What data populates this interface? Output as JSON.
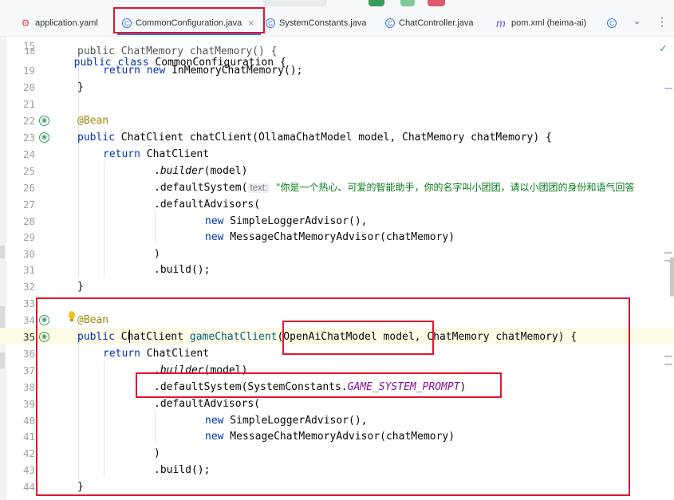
{
  "tabs": [
    {
      "label": "application.yaml",
      "icon": "yaml-icon"
    },
    {
      "label": "CommonConfiguration.java",
      "icon": "class-icon",
      "active": true,
      "closable": true
    },
    {
      "label": "SystemConstants.java",
      "icon": "class-icon"
    },
    {
      "label": "ChatController.java",
      "icon": "class-icon"
    },
    {
      "label": "pom.xml (heima-ai)",
      "icon": "maven-icon"
    }
  ],
  "tab_close_glyph": "×",
  "sticky_header": {
    "line": "15",
    "text": "public class CommonConfiguration {"
  },
  "line_numbers": [
    "18",
    "19",
    "20",
    "21",
    "22",
    "23",
    "24",
    "25",
    "26",
    "27",
    "28",
    "29",
    "30",
    "31",
    "32",
    "33",
    "34",
    "35",
    "36",
    "37",
    "38",
    "39",
    "40",
    "41",
    "42",
    "43",
    "44"
  ],
  "code": {
    "l18": "public ChatMemory chatMemory() {",
    "l19_kw": "return new",
    "l19_rest": " InMemoryChatMemory();",
    "l20": "}",
    "l22": "@Bean",
    "l23_kw": "public",
    "l23_type": "ChatClient",
    "l23_rest": " chatClient(OllamaChatModel model, ChatMemory chatMemory) {",
    "l24_kw": "return",
    "l24_type": "ChatClient",
    "l25_dot": ".",
    "l25_it": "builder",
    "l25_rest": "(model)",
    "l26_a": ".defaultSystem(",
    "l26_hint": "text:",
    "l26_str": "\"你是一个热心、可爱的智能助手，你的名字叫小团团，请以小团团的身份和语气回答",
    "l27": ".defaultAdvisors(",
    "l28_kw": "new",
    "l28_rest": " SimpleLoggerAdvisor(),",
    "l29_kw": "new",
    "l29_rest": " MessageChatMemoryAdvisor(chatMemory)",
    "l30": ")",
    "l31": ".build();",
    "l32": "}",
    "l34": "@Bean",
    "l35_kw": "public",
    "l35_a": "C",
    "l35_b": "hatClient",
    "l35_c": " gameChatClient",
    "l35_d": "(OpenAiChatModel model, ChatMemory chatMemory) {",
    "l36_kw": "return",
    "l36_type": "ChatClient",
    "l37_dot": ".",
    "l37_it": "builder",
    "l37_rest": "(model)",
    "l38_a": ".defaultSystem(SystemConstants.",
    "l38_cst": "GAME_SYSTEM_PROMPT",
    "l38_b": ")",
    "l39": ".defaultAdvisors(",
    "l40_kw": "new",
    "l40_rest": " SimpleLoggerAdvisor(),",
    "l41_kw": "new",
    "l41_rest": " MessageChatMemoryAdvisor(chatMemory)",
    "l42": ")",
    "l43": ".build();",
    "l44": "}"
  },
  "colors": {
    "keyword": "#0033b3",
    "annotation": "#9e880d",
    "string": "#067d17",
    "constant": "#871094",
    "highlight_box": "#e0162b",
    "active_tab_underline": "#3574f0"
  }
}
